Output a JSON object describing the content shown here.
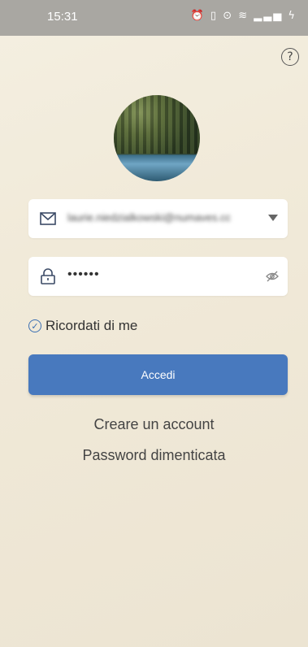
{
  "status_bar": {
    "time": "15:31",
    "icons": [
      "alarm-icon",
      "vibrate-icon",
      "location-icon",
      "wifi-icon",
      "signal-icon",
      "battery-charging-icon"
    ]
  },
  "help": {
    "label": "?"
  },
  "login": {
    "email_value": "laurie.niedzialkowski@numaves.cc",
    "password_value": "••••••",
    "remember_label": "Ricordati di me",
    "remember_checked": true,
    "submit_label": "Accedi"
  },
  "links": {
    "create_account": "Creare un account",
    "forgot_password": "Password dimenticata"
  },
  "colors": {
    "accent": "#4879be",
    "status_bar": "#a9a7a2",
    "background": "#f1ead9"
  }
}
